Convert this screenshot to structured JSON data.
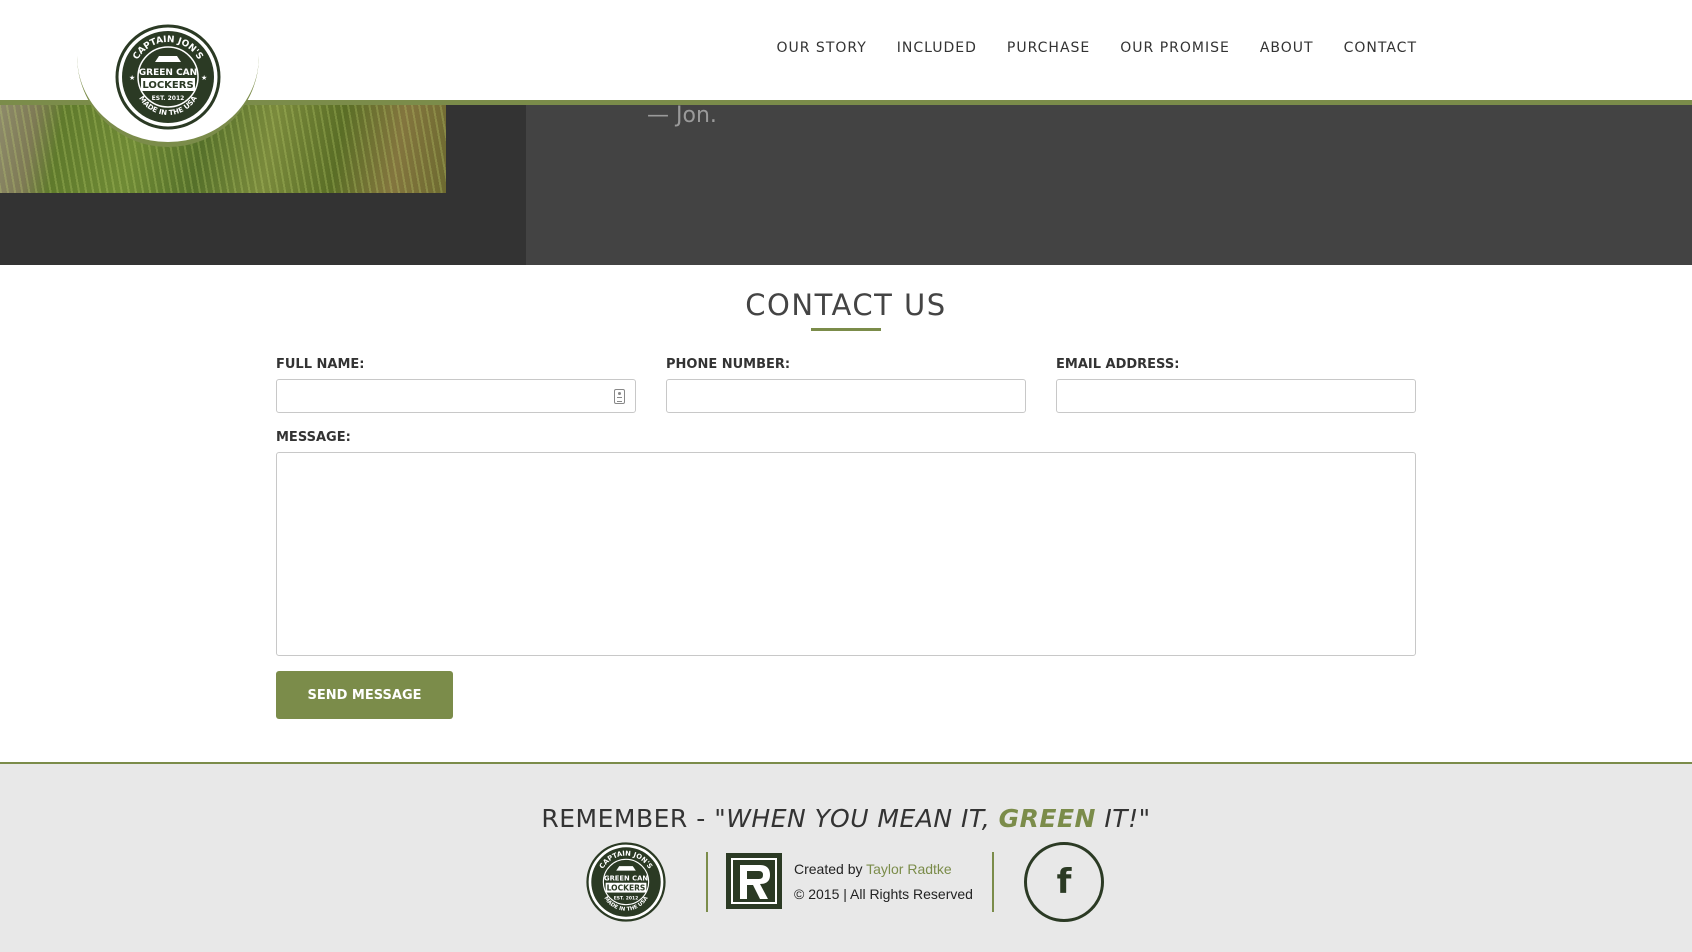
{
  "header": {
    "logo": {
      "top_text": "CAPTAIN JON'S",
      "line1": "GREEN CAN",
      "line2": "LOCKERS",
      "est": "EST. 2012",
      "bottom_text": "MADE IN THE USA"
    },
    "nav": [
      {
        "label": "OUR STORY"
      },
      {
        "label": "INCLUDED"
      },
      {
        "label": "PURCHASE"
      },
      {
        "label": "OUR PROMISE"
      },
      {
        "label": "ABOUT"
      },
      {
        "label": "CONTACT"
      }
    ]
  },
  "hero": {
    "quote_attribution": "— Jon."
  },
  "contact": {
    "title": "CONTACT US",
    "full_name_label": "FULL NAME:",
    "full_name_value": "",
    "phone_label": "PHONE NUMBER:",
    "phone_value": "",
    "email_label": "EMAIL ADDRESS:",
    "email_value": "",
    "message_label": "MESSAGE:",
    "message_value": "",
    "send_label": "SEND MESSAGE"
  },
  "footer": {
    "remember_prefix": "REMEMBER - ",
    "remember_quote_start": "\"WHEN YOU MEAN IT, ",
    "remember_green": "GREEN",
    "remember_quote_end": " IT!\"",
    "created_by": "Created by",
    "author": "Taylor Radtke",
    "copyright": "© 2015 | All Rights Reserved",
    "facebook_glyph": "f"
  },
  "colors": {
    "accent": "#7b8c4a",
    "dark_green": "#2b3a24",
    "hero_dark": "#434343",
    "footer_bg": "#e8e8e8"
  }
}
